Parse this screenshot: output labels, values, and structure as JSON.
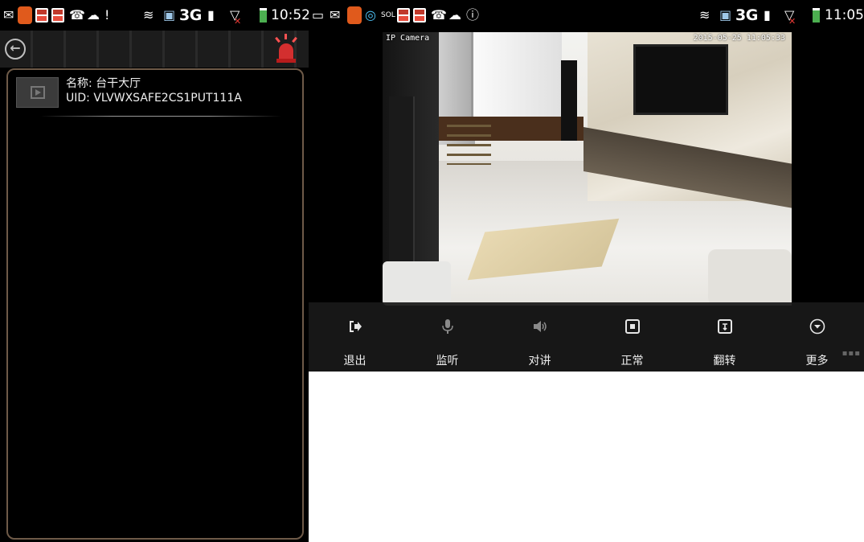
{
  "left_screen": {
    "status_bar": {
      "time": "10:52",
      "network": "3G"
    },
    "toolbar": {
      "back_icon": "back-circle-arrow-icon",
      "alarm_icon": "alarm-siren-icon"
    },
    "device": {
      "name_label": "名称: 台干大厅",
      "uid_label": "UID: VLVWXSAFE2CS1PUT111A"
    }
  },
  "right_screen": {
    "status_bar": {
      "time": "11:05",
      "network": "3G"
    },
    "video": {
      "overlay_title": "IP Camera",
      "overlay_timestamp": "2015-05-25 11:05:33"
    },
    "controls": [
      {
        "label": "退出",
        "icon": "exit-icon"
      },
      {
        "label": "监听",
        "icon": "microphone-icon"
      },
      {
        "label": "对讲",
        "icon": "speaker-icon"
      },
      {
        "label": "正常",
        "icon": "normal-view-icon"
      },
      {
        "label": "翻转",
        "icon": "flip-icon"
      },
      {
        "label": "更多",
        "icon": "more-chevron-icon"
      }
    ]
  },
  "colors": {
    "panel_border": "#6e5a48",
    "alarm_red": "#d32f2f",
    "battery_green": "#4caf50"
  }
}
